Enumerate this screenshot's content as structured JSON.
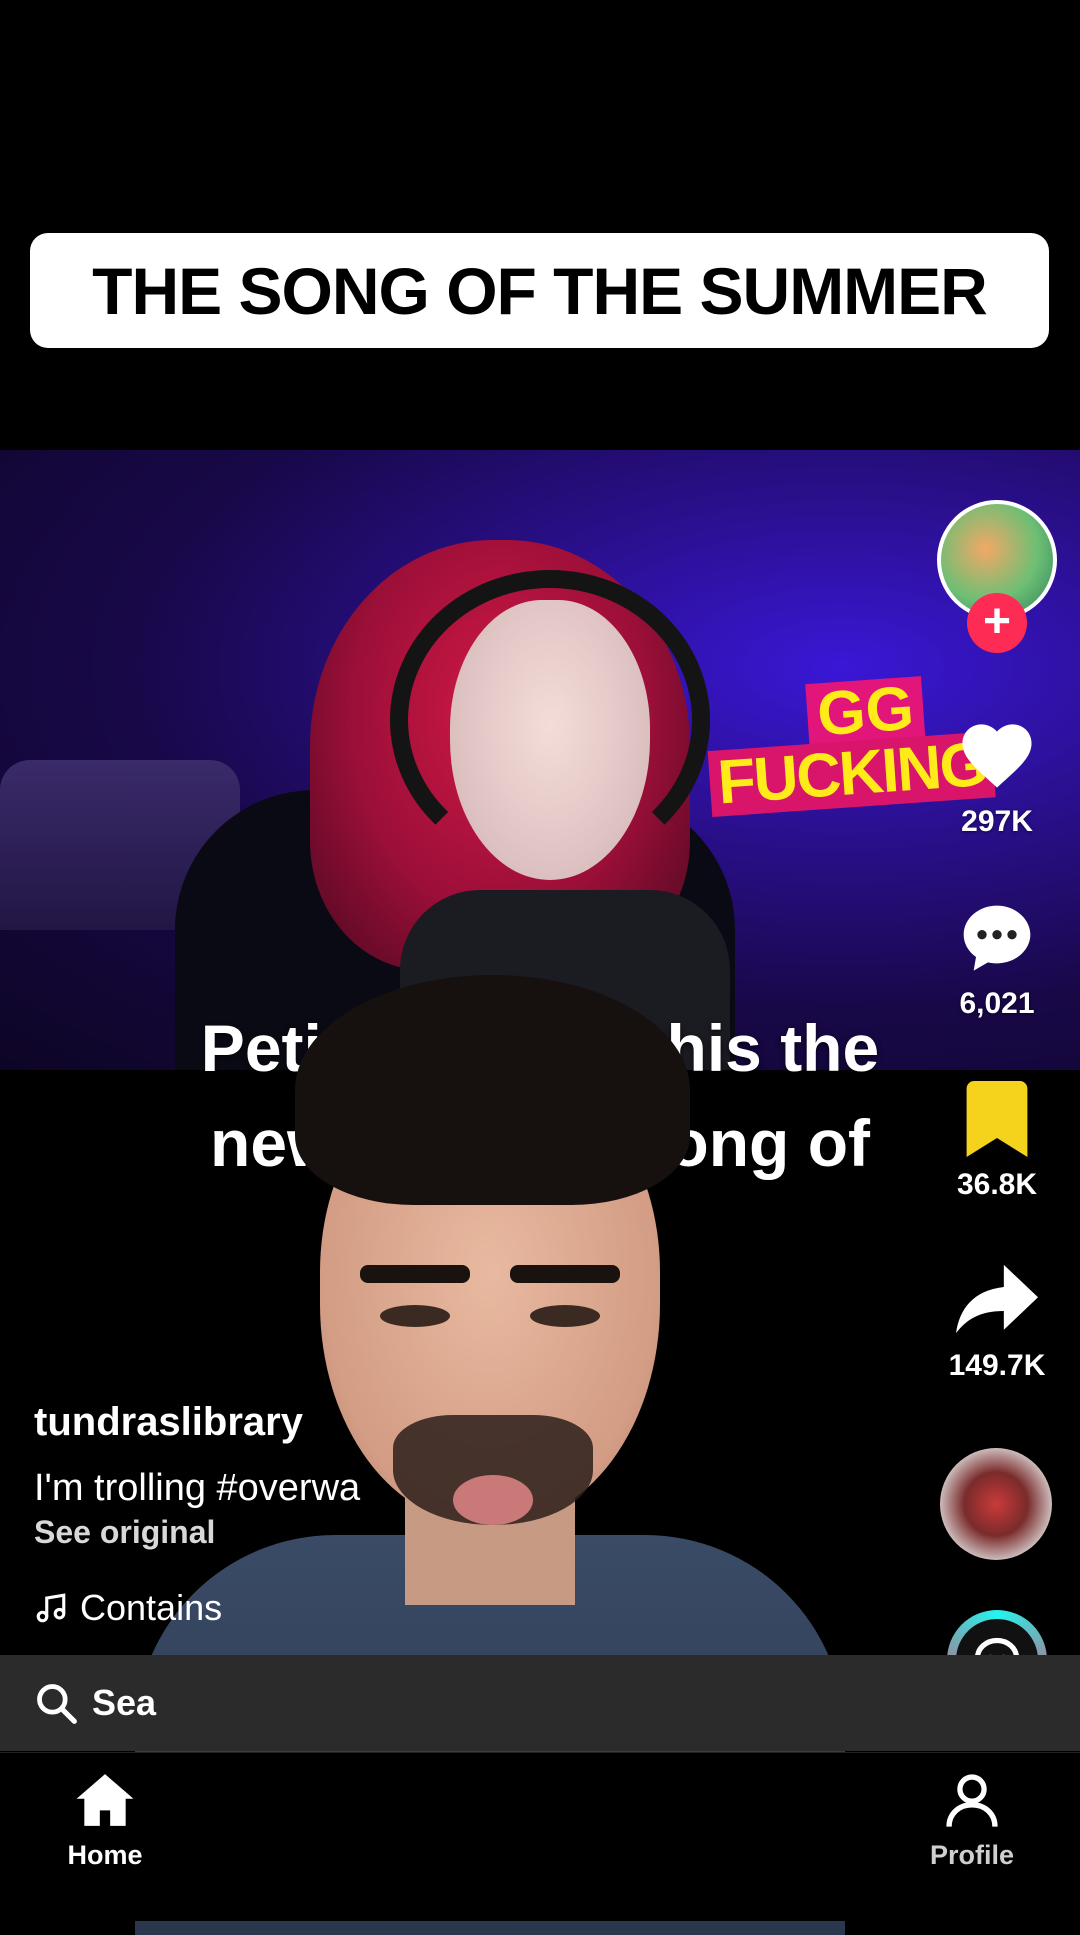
{
  "overlay": {
    "title_banner": "THE SONG OF THE SUMMER"
  },
  "video": {
    "sticker_line1": "GG",
    "sticker_line2": "FUCKING",
    "caption_line1": "Petition        e this the",
    "caption_line2": "new                  ong of"
  },
  "rail": {
    "likes": "297K",
    "comments": "6,021",
    "saves": "36.8K",
    "shares": "149.7K",
    "follow_symbol": "+"
  },
  "post": {
    "username": "tundraslibrary",
    "description": "I'm trolling #overwa",
    "see_original": "See original",
    "music": "Contains"
  },
  "search": {
    "label": "Sea"
  },
  "nav": {
    "home": "Home",
    "profile": "Profile"
  },
  "colors": {
    "follow": "#fe2c55",
    "save": "#f5d21b",
    "search_bg": "#2b2b2b"
  }
}
